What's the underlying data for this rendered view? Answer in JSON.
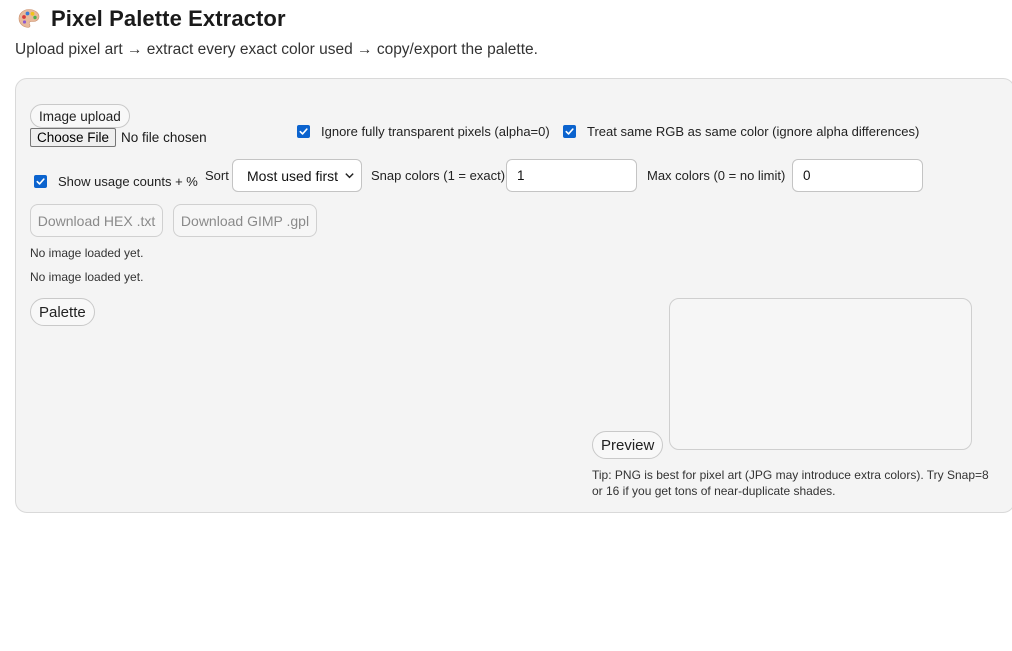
{
  "header": {
    "title": "Pixel Palette Extractor",
    "subtitle": "Upload pixel art → extract every exact color used → copy/export the palette.",
    "icon": "artist-palette-icon"
  },
  "upload": {
    "label": "Image upload",
    "button_label": "Choose File",
    "status": "No file chosen"
  },
  "options": {
    "ignore_transparent": {
      "label": "Ignore fully transparent pixels (alpha=0)",
      "checked": true
    },
    "treat_same_rgb": {
      "label": "Treat same RGB as same color (ignore alpha differences)",
      "checked": true
    },
    "show_usage": {
      "label": "Show usage counts + %",
      "checked": true
    },
    "sort": {
      "label": "Sort",
      "selected": "Most used first"
    },
    "snap": {
      "label": "Snap colors (1 = exact)",
      "value": "1"
    },
    "max_colors": {
      "label": "Max colors (0 = no limit)",
      "value": "0"
    }
  },
  "downloads": {
    "hex": "Download HEX .txt",
    "gimp": "Download GIMP .gpl"
  },
  "status": {
    "line1": "No image loaded yet.",
    "line2": "No image loaded yet."
  },
  "sections": {
    "palette": "Palette",
    "preview": "Preview"
  },
  "tip": "Tip: PNG is best for pixel art (JPG may introduce extra colors). Try Snap=8 or 16 if you get tons of near-duplicate shades.",
  "colors": {
    "accent": "#0b63ce",
    "panel_bg": "#f4f4f4"
  }
}
